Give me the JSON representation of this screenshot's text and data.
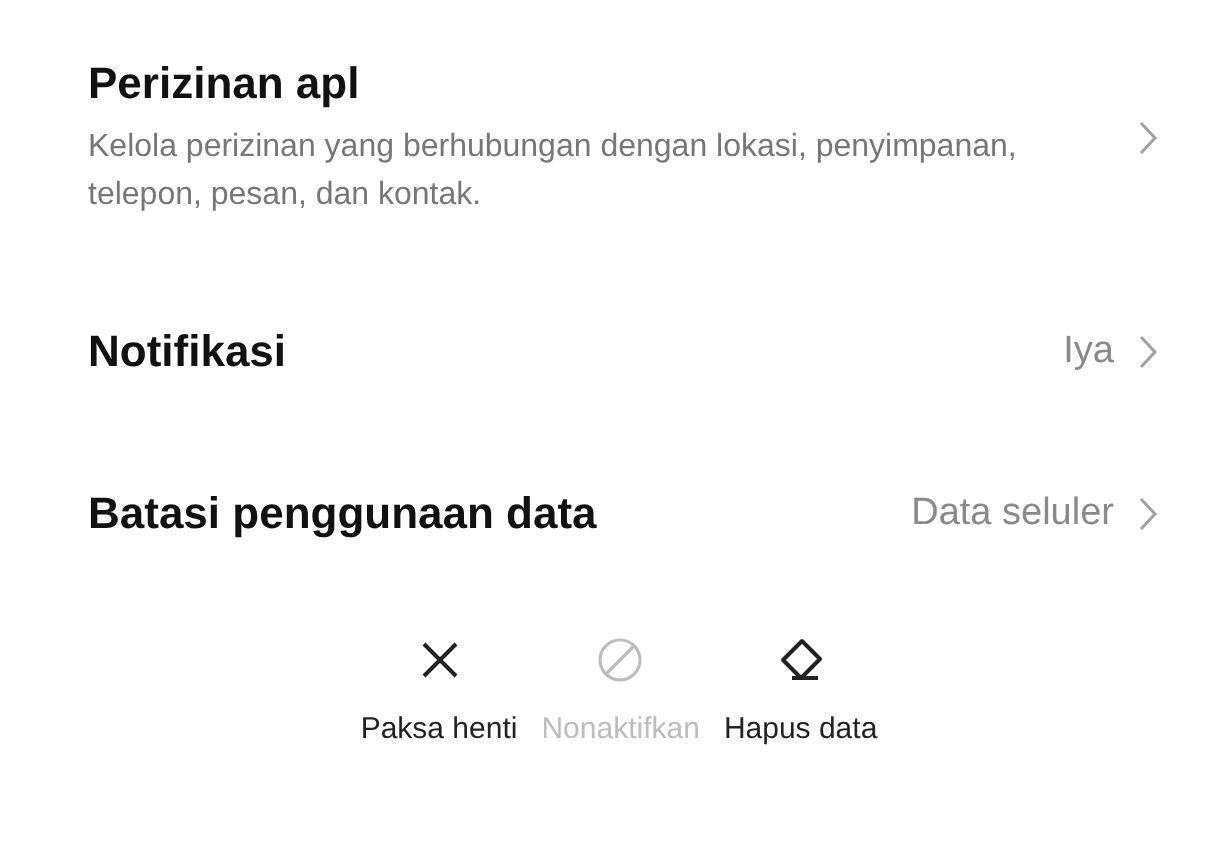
{
  "settings": [
    {
      "title": "Perizinan apl",
      "description": "Kelola perizinan yang berhubungan dengan lokasi, penyimpanan, telepon, pesan, dan kontak."
    },
    {
      "title": "Notifikasi",
      "value": "Iya"
    },
    {
      "title": "Batasi penggunaan data",
      "value": "Data seluler"
    }
  ],
  "actions": [
    {
      "kind": "close",
      "label": "Paksa henti",
      "disabled": false
    },
    {
      "kind": "block",
      "label": "Nonaktifkan",
      "disabled": true
    },
    {
      "kind": "eraser",
      "label": "Hapus data",
      "disabled": false
    }
  ]
}
